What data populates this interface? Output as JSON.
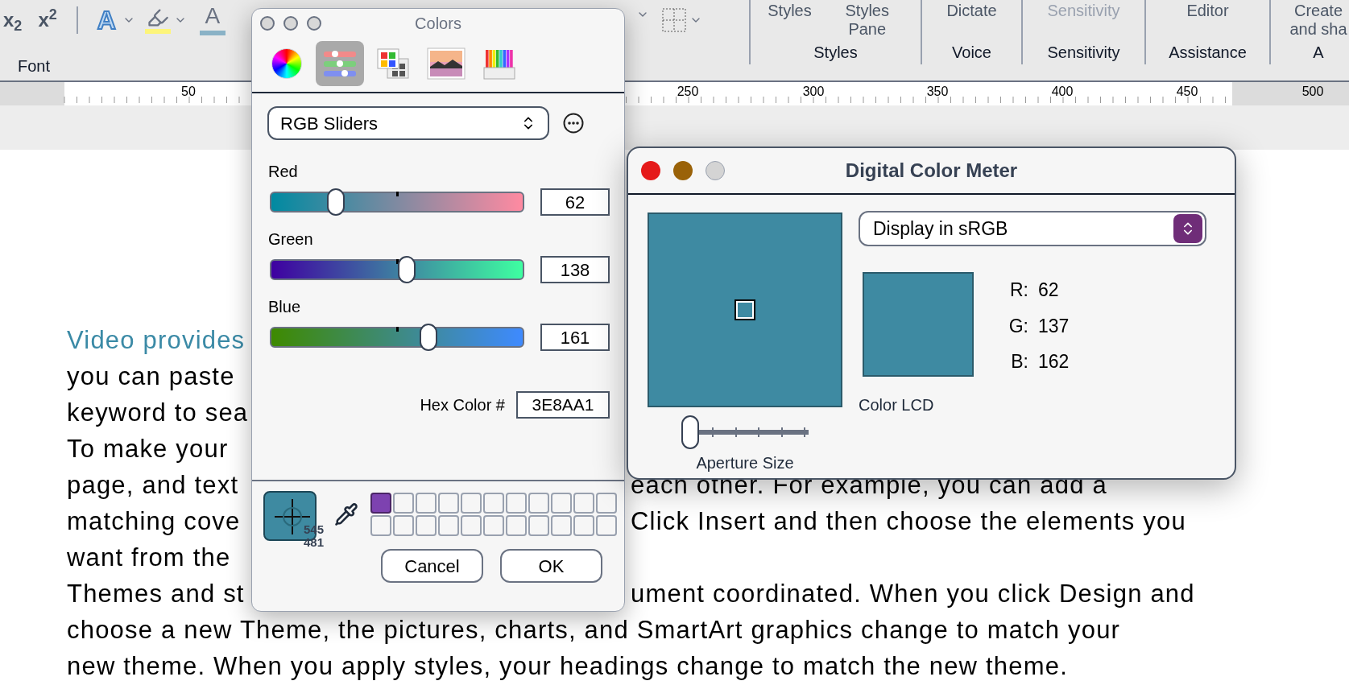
{
  "ribbon": {
    "font_group": {
      "label": "Font",
      "buttons": [
        {
          "kind": "subscript",
          "label": "x$_{2}$",
          "menu": false
        },
        {
          "kind": "superscript",
          "label": "x$^{2}$",
          "menu": false
        },
        {
          "kind": "text_effects",
          "label": "A",
          "menu": true
        },
        {
          "kind": "highlight",
          "menu": true
        },
        {
          "kind": "font_color",
          "label": "A",
          "menu": false
        }
      ]
    },
    "layout_controls": [
      {
        "kind": "chevron"
      },
      {
        "kind": "borders",
        "menu": true
      }
    ],
    "groups": [
      {
        "label": "Styles",
        "buttons": [
          {
            "label": "Styles",
            "disabled": false
          },
          {
            "label": "Styles Pane",
            "disabled": false
          }
        ]
      },
      {
        "label": "Voice",
        "buttons": [
          {
            "label": "Dictate",
            "disabled": false
          }
        ]
      },
      {
        "label": "Sensitivity",
        "buttons": [
          {
            "label": "Sensitivity",
            "disabled": true
          }
        ]
      },
      {
        "label": "Assistance",
        "buttons": [
          {
            "label": "Editor",
            "disabled": false
          }
        ]
      },
      {
        "label": "A",
        "buttons": [
          {
            "label": "Create and sha",
            "disabled": false
          }
        ]
      }
    ]
  },
  "ruler": {
    "numbers": [
      "50",
      "250",
      "300",
      "350",
      "400",
      "450",
      "500"
    ]
  },
  "document": {
    "heading": "Video provides",
    "lines": [
      {
        "kind": "split",
        "left": "you can paste"
      },
      {
        "kind": "split",
        "left": "keyword to sea"
      },
      {
        "kind": "split",
        "left": "To make your"
      },
      {
        "kind": "split",
        "left": "page, and text",
        "right": "each other. For example, you can add a"
      },
      {
        "kind": "split",
        "left": "matching cove",
        "right": "Click Insert and then choose the elements you"
      },
      {
        "kind": "split",
        "left": "want from the"
      },
      {
        "kind": "split",
        "left": "Themes and st",
        "right": "ument coordinated. When you click Design and"
      },
      {
        "kind": "full",
        "text": "choose a new Theme, the pictures, charts, and SmartArt graphics change to match your"
      },
      {
        "kind": "full",
        "text": "new theme. When you apply styles, your headings change to match the new theme."
      }
    ]
  },
  "colors_window": {
    "title": "Colors",
    "tabs": [
      {
        "kind": "wheel",
        "selected": false
      },
      {
        "kind": "sliders",
        "selected": true
      },
      {
        "kind": "palettes",
        "selected": false
      },
      {
        "kind": "image",
        "selected": false
      },
      {
        "kind": "pencils",
        "selected": false
      }
    ],
    "mode": "RGB Sliders",
    "sliders": [
      {
        "label": "Red",
        "level": 0.243,
        "value": "62"
      },
      {
        "label": "Green",
        "level": 0.541,
        "value": "138"
      },
      {
        "label": "Blue",
        "level": 0.631,
        "value": "161"
      }
    ],
    "hex_label": "Hex Color #",
    "hex_value": "3E8AA1",
    "cursor_coords": [
      "545",
      "481"
    ],
    "swatches": [
      {
        "color": "#7d42b0"
      },
      {
        "empty": true
      },
      {
        "empty": true
      },
      {
        "empty": true
      },
      {
        "empty": true
      },
      {
        "empty": true
      },
      {
        "empty": true
      },
      {
        "empty": true
      },
      {
        "empty": true
      },
      {
        "empty": true
      },
      {
        "empty": true
      },
      {
        "empty": true
      },
      {
        "empty": true
      },
      {
        "empty": true
      },
      {
        "empty": true
      },
      {
        "empty": true
      },
      {
        "empty": true
      },
      {
        "empty": true
      },
      {
        "empty": true
      },
      {
        "empty": true
      },
      {
        "empty": true
      },
      {
        "empty": true
      }
    ],
    "buttons": [
      "Cancel",
      "OK"
    ]
  },
  "color_meter": {
    "title": "Digital Color Meter",
    "display_mode": "Display in sRGB",
    "readings": [
      {
        "label": "R:",
        "value": "62"
      },
      {
        "label": "G:",
        "value": "137"
      },
      {
        "label": "B:",
        "value": "162"
      }
    ],
    "display_name": "Color LCD",
    "aperture": {
      "label": "Aperture Size",
      "level": 0
    }
  }
}
